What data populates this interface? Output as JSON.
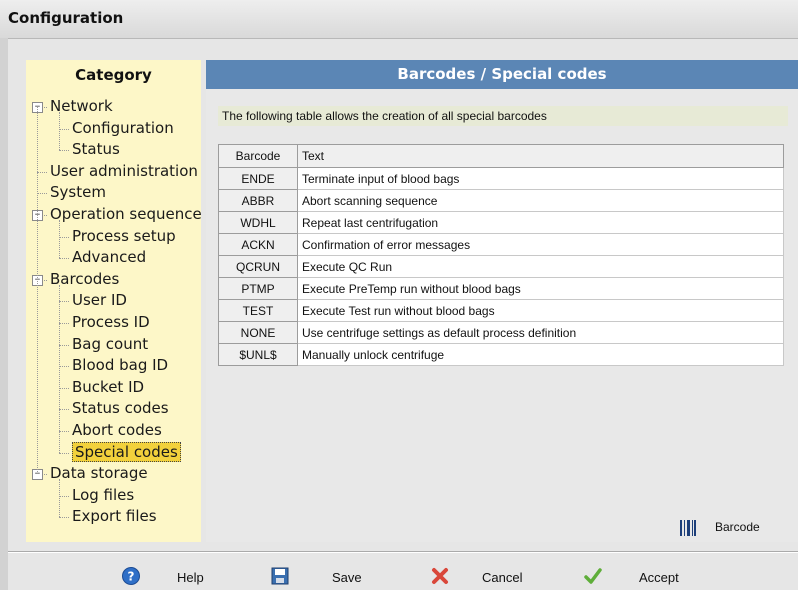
{
  "window": {
    "title": "Configuration"
  },
  "category": {
    "header": "Category",
    "tree": [
      {
        "label": "Network",
        "level": 0,
        "expander": "−"
      },
      {
        "label": "Configuration",
        "level": 1
      },
      {
        "label": "Status",
        "level": 1
      },
      {
        "label": "User administration",
        "level": 0
      },
      {
        "label": "System",
        "level": 0
      },
      {
        "label": "Operation sequence",
        "level": 0,
        "expander": "−"
      },
      {
        "label": "Process setup",
        "level": 1
      },
      {
        "label": "Advanced",
        "level": 1
      },
      {
        "label": "Barcodes",
        "level": 0,
        "expander": "−"
      },
      {
        "label": "User ID",
        "level": 1
      },
      {
        "label": "Process ID",
        "level": 1
      },
      {
        "label": "Bag count",
        "level": 1
      },
      {
        "label": "Blood bag ID",
        "level": 1
      },
      {
        "label": "Bucket ID",
        "level": 1
      },
      {
        "label": "Status codes",
        "level": 1
      },
      {
        "label": "Abort codes",
        "level": 1
      },
      {
        "label": "Special codes",
        "level": 1,
        "selected": true
      },
      {
        "label": "Data storage",
        "level": 0,
        "expander": "−"
      },
      {
        "label": "Log files",
        "level": 1
      },
      {
        "label": "Export files",
        "level": 1
      }
    ]
  },
  "panel": {
    "header": "Barcodes / Special codes",
    "description": "The following table allows the creation of all special barcodes",
    "table": {
      "columns": [
        "Barcode",
        "Text"
      ],
      "rows": [
        [
          "ENDE",
          "Terminate input of blood bags"
        ],
        [
          "ABBR",
          "Abort scanning sequence"
        ],
        [
          "WDHL",
          "Repeat last centrifugation"
        ],
        [
          "ACKN",
          "Confirmation of error messages"
        ],
        [
          "QCRUN",
          "Execute QC Run"
        ],
        [
          "PTMP",
          "Execute PreTemp run without blood bags"
        ],
        [
          "TEST",
          "Execute Test run without blood bags"
        ],
        [
          "NONE",
          "Use centrifuge settings as default process definition"
        ],
        [
          "$UNL$",
          "Manually unlock centrifuge"
        ]
      ]
    },
    "barcode_button": {
      "label": "Barcode",
      "icon": "barcode-icon"
    }
  },
  "footer": {
    "help": {
      "label": "Help",
      "icon": "help-icon",
      "color": "#2f6fc7"
    },
    "save": {
      "label": "Save",
      "icon": "floppy-disk-icon",
      "color": "#3a6fb0"
    },
    "cancel": {
      "label": "Cancel",
      "icon": "red-x-icon",
      "color": "#d9473a"
    },
    "accept": {
      "label": "Accept",
      "icon": "checkmark-icon",
      "color": "#5fae3a"
    }
  },
  "colors": {
    "panel_header": "#5b86b5",
    "category_bg": "#fdf7c8",
    "selected_bg": "#f2d13c",
    "description_bg": "#e7ead6"
  }
}
